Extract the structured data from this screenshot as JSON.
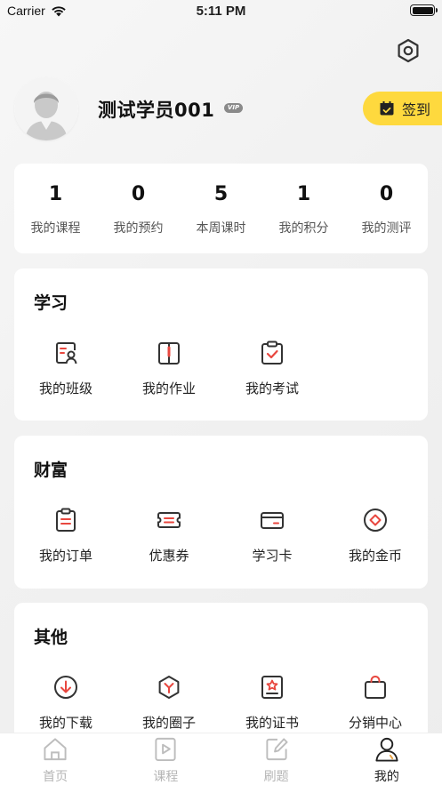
{
  "status_bar": {
    "carrier": "Carrier",
    "time": "5:11 PM"
  },
  "profile": {
    "name": "测试学员001",
    "vip": "VIP",
    "checkin_label": "签到"
  },
  "stats": [
    {
      "value": "1",
      "label": "我的课程"
    },
    {
      "value": "0",
      "label": "我的预约"
    },
    {
      "value": "5",
      "label": "本周课时"
    },
    {
      "value": "1",
      "label": "我的积分"
    },
    {
      "value": "0",
      "label": "我的测评"
    }
  ],
  "study": {
    "title": "学习",
    "items": [
      {
        "label": "我的班级",
        "icon": "class-icon"
      },
      {
        "label": "我的作业",
        "icon": "homework-icon"
      },
      {
        "label": "我的考试",
        "icon": "exam-icon"
      }
    ]
  },
  "wealth": {
    "title": "财富",
    "items": [
      {
        "label": "我的订单",
        "icon": "order-icon"
      },
      {
        "label": "优惠券",
        "icon": "coupon-icon"
      },
      {
        "label": "学习卡",
        "icon": "study-card-icon"
      },
      {
        "label": "我的金币",
        "icon": "coin-icon"
      }
    ]
  },
  "other": {
    "title": "其他",
    "items": [
      {
        "label": "我的下载",
        "icon": "download-icon"
      },
      {
        "label": "我的圈子",
        "icon": "circle-icon"
      },
      {
        "label": "我的证书",
        "icon": "certificate-icon"
      },
      {
        "label": "分销中心",
        "icon": "distribution-icon"
      }
    ]
  },
  "tabbar": [
    {
      "label": "首页",
      "icon": "home-icon",
      "active": false
    },
    {
      "label": "课程",
      "icon": "course-icon",
      "active": false
    },
    {
      "label": "刷题",
      "icon": "practice-icon",
      "active": false
    },
    {
      "label": "我的",
      "icon": "profile-icon",
      "active": true
    }
  ],
  "colors": {
    "accent": "#fed93e",
    "icon_red": "#e8473f",
    "icon_dark": "#333333",
    "background": "#f2f2f2"
  }
}
